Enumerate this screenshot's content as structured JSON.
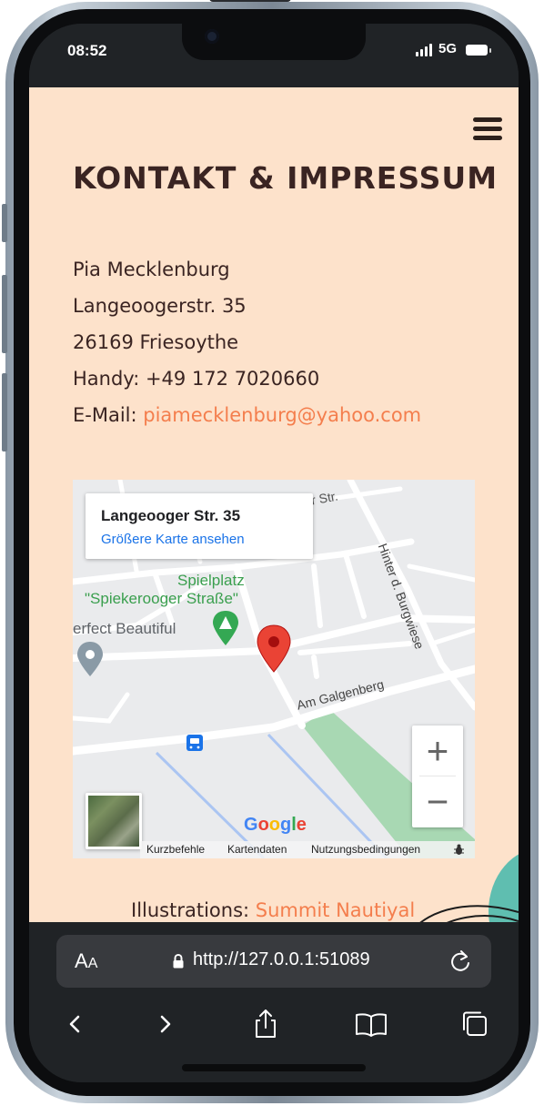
{
  "status_bar": {
    "time": "08:52",
    "network": "5G"
  },
  "page": {
    "title": "KONTAKT & IMPRESSUM",
    "address": {
      "name": "Pia Mecklenburg",
      "street": "Langeoogerstr. 35",
      "city": "26169 Friesoythe",
      "phone": "Handy: +49 172 7020660",
      "email_label": "E-Mail: ",
      "email": "piamecklenburg@yahoo.com"
    },
    "credit_label": "Illustrations: ",
    "credit_link": "Summit Nautiyal"
  },
  "map": {
    "card_title": "Langeooger Str. 35",
    "card_link": "Größere Karte ansehen",
    "labels": {
      "partial_street": "r Str.",
      "playground_1": "Spielplatz",
      "playground_2": "\"Spiekerooger Straße\"",
      "business": "erfect Beautiful",
      "hinter": "Hinter d. Burgwiese",
      "galgenberg": "Am Galgenberg"
    },
    "zoom_in": "+",
    "zoom_out": "−",
    "footer": {
      "shortcuts": "Kurzbefehle",
      "map_data": "Kartendaten",
      "terms": "Nutzungsbedingungen"
    },
    "logo": [
      "G",
      "o",
      "o",
      "g",
      "l",
      "e"
    ],
    "colors": {
      "marker": "#ea4335",
      "park_label": "#3a9f4e",
      "link": "#1a73e8",
      "bus": "#1a73e8"
    }
  },
  "browser": {
    "aa_large": "A",
    "aa_small": "A",
    "url": "http://127.0.0.1:51089"
  },
  "colors": {
    "page_bg": "#fde2cb",
    "heading": "#3a2422",
    "accent": "#f47e4d",
    "toolbar": "#202326"
  }
}
